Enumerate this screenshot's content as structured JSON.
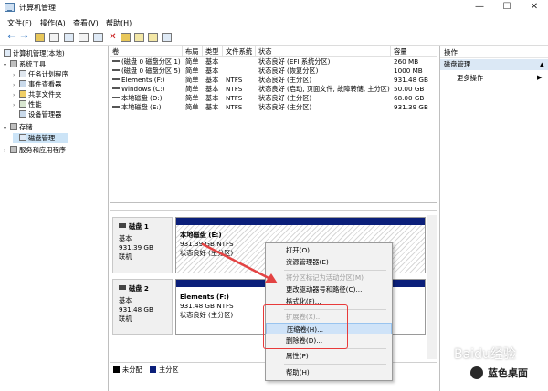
{
  "window": {
    "title": "计算机管理",
    "controls": [
      "—",
      "☐",
      "✕"
    ]
  },
  "menubar": [
    "文件(F)",
    "操作(A)",
    "查看(V)",
    "帮助(H)"
  ],
  "tree": {
    "root": "计算机管理(本地)",
    "items": [
      {
        "label": "系统工具",
        "level": 1,
        "expander": "▾"
      },
      {
        "label": "任务计划程序",
        "level": 2,
        "expander": "›"
      },
      {
        "label": "事件查看器",
        "level": 2,
        "expander": "›"
      },
      {
        "label": "共享文件夹",
        "level": 2,
        "expander": "›"
      },
      {
        "label": "性能",
        "level": 2,
        "expander": "›"
      },
      {
        "label": "设备管理器",
        "level": 2,
        "expander": ""
      },
      {
        "label": "存储",
        "level": 1,
        "expander": "▾"
      },
      {
        "label": "磁盘管理",
        "level": 2,
        "expander": "",
        "selected": true
      },
      {
        "label": "服务和应用程序",
        "level": 1,
        "expander": "›"
      }
    ]
  },
  "volume_table": {
    "columns": [
      "卷",
      "布局",
      "类型",
      "文件系统",
      "状态",
      "容量"
    ],
    "rows": [
      [
        "(磁盘 0 磁盘分区 1)",
        "简单",
        "基本",
        "",
        "状态良好 (EFI 系统分区)",
        "260 MB"
      ],
      [
        "(磁盘 0 磁盘分区 5)",
        "简单",
        "基本",
        "",
        "状态良好 (恢复分区)",
        "1000 MB"
      ],
      [
        "Elements (F:)",
        "简单",
        "基本",
        "NTFS",
        "状态良好 (主分区)",
        "931.48 GB"
      ],
      [
        "Windows (C:)",
        "简单",
        "基本",
        "NTFS",
        "状态良好 (启动, 页面文件, 故障转储, 主分区)",
        "50.00 GB"
      ],
      [
        "本地磁盘 (D:)",
        "简单",
        "基本",
        "NTFS",
        "状态良好 (主分区)",
        "68.00 GB"
      ],
      [
        "本地磁盘 (E:)",
        "简单",
        "基本",
        "NTFS",
        "状态良好 (主分区)",
        "931.39 GB"
      ]
    ]
  },
  "disks": [
    {
      "name": "磁盘 1",
      "type": "基本",
      "size": "931.39 GB",
      "status": "联机",
      "partition": {
        "label": "本地磁盘 (E:)",
        "detail": "931.39 GB NTFS",
        "status": "状态良好 (主分区)"
      }
    },
    {
      "name": "磁盘 2",
      "type": "基本",
      "size": "931.48 GB",
      "status": "联机",
      "partition": {
        "label": "Elements (F:)",
        "detail": "931.48 GB NTFS",
        "status": "状态良好 (主分区)"
      }
    }
  ],
  "legend": [
    {
      "label": "未分配",
      "color": "#000000"
    },
    {
      "label": "主分区",
      "color": "#0b1f7a"
    }
  ],
  "actions": {
    "header": "操作",
    "selected": "磁盘管理",
    "more": "更多操作"
  },
  "context_menu": [
    {
      "label": "打开(O)",
      "disabled": false
    },
    {
      "label": "资源管理器(E)",
      "disabled": false
    },
    {
      "separator": true
    },
    {
      "label": "将分区标记为活动分区(M)",
      "disabled": true
    },
    {
      "label": "更改驱动器号和路径(C)...",
      "disabled": false
    },
    {
      "label": "格式化(F)...",
      "disabled": false
    },
    {
      "separator": true
    },
    {
      "label": "扩展卷(X)...",
      "disabled": true
    },
    {
      "label": "压缩卷(H)...",
      "disabled": false,
      "highlighted": true
    },
    {
      "label": "删除卷(D)...",
      "disabled": false
    },
    {
      "separator": true
    },
    {
      "label": "属性(P)",
      "disabled": false
    },
    {
      "separator": true
    },
    {
      "label": "帮助(H)",
      "disabled": false
    }
  ],
  "watermark": {
    "brand": "Baidu经验",
    "channel": "蓝色桌面"
  },
  "colors": {
    "primary_partition": "#0b1f7a",
    "highlight_box": "#e83a3a",
    "selection": "#cce4f7"
  }
}
